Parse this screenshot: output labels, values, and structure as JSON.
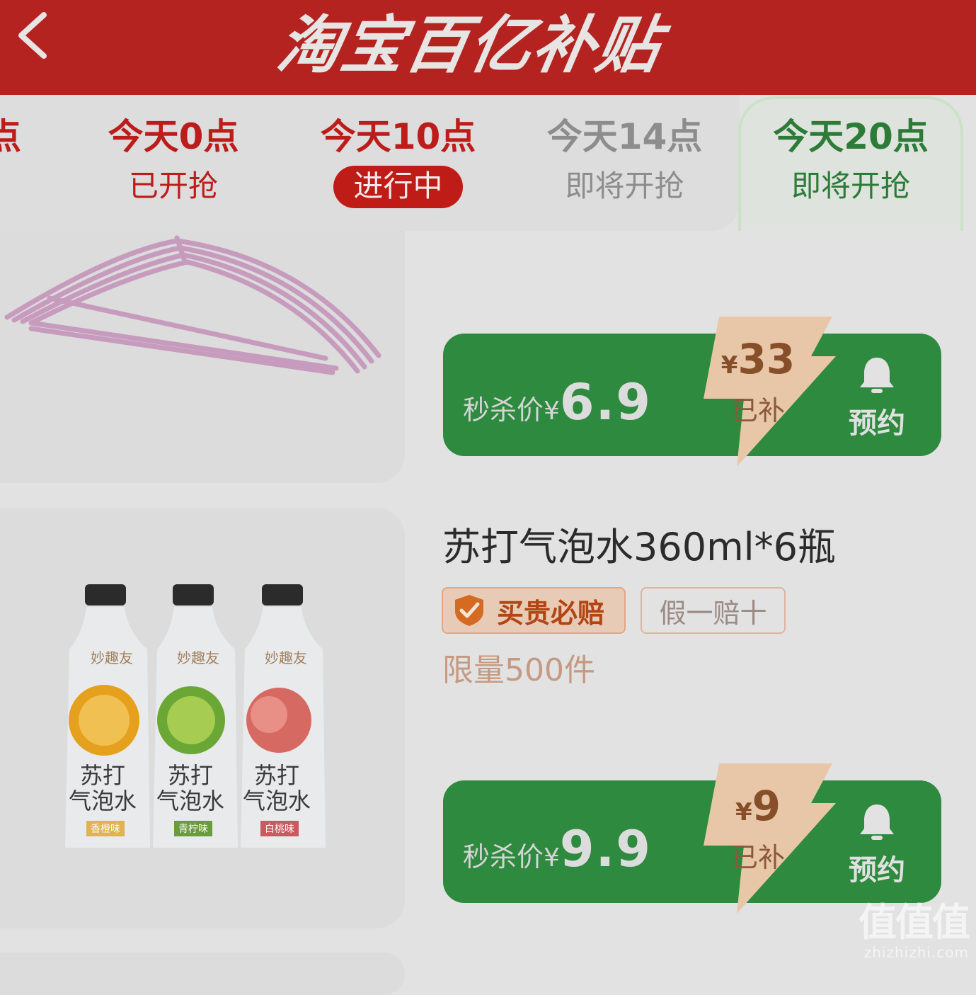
{
  "header": {
    "title": "淘宝百亿补贴",
    "back_icon": "chevron-left-icon",
    "bg_color": "#b4231f"
  },
  "tabs": [
    {
      "time": "点",
      "status": ""
    },
    {
      "time": "今天0点",
      "status": "已开抢"
    },
    {
      "time": "今天10点",
      "status": "进行中"
    },
    {
      "time": "今天14点",
      "status": "即将开抢"
    },
    {
      "time": "今天20点",
      "status": "即将开抢"
    }
  ],
  "products": [
    {
      "image": "clothes-hanger",
      "price_label": "秒杀价",
      "currency": "¥",
      "price": "6.9",
      "subsidy_currency": "¥",
      "subsidy": "33",
      "subsidy_label": "已补",
      "action": "预约"
    },
    {
      "image": "soda-water-bottles",
      "title": "苏打气泡水360ml*6瓶",
      "badge_guarantee": "买贵必赔",
      "badge_fake": "假一赔十",
      "limit": "限量500件",
      "price_label": "秒杀价",
      "currency": "¥",
      "price": "9.9",
      "subsidy_currency": "¥",
      "subsidy": "9",
      "subsidy_label": "已补",
      "action": "预约",
      "bottle_brand": "妙趣友",
      "bottle_name_1": "苏打",
      "bottle_name_2": "气泡水",
      "bottle_flavors": [
        "香橙味",
        "青柠味",
        "白桃味"
      ]
    }
  ],
  "watermark": {
    "logo": "值值值",
    "site": "zhizhizhi.com"
  },
  "colors": {
    "accent_red": "#bd1d1a",
    "accent_green": "#2d8a3e",
    "subsidy_bg": "#e8c7a8"
  }
}
